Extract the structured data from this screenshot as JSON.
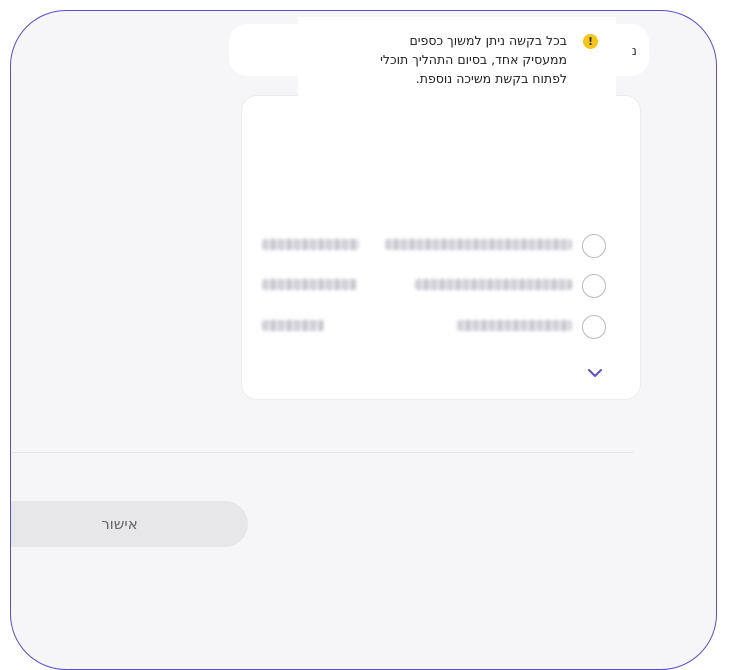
{
  "top_card": {
    "partial_text": "נ"
  },
  "tooltip": {
    "icon": "warning-icon",
    "lines": [
      "בכל בקשה ניתן למשוך כספים",
      "ממעסיק אחד, בסיום התהליך תוכלי",
      "לפתוח בקשת משיכה נוספת."
    ]
  },
  "options": [
    {
      "selected": false
    },
    {
      "selected": false
    },
    {
      "selected": false
    }
  ],
  "expand_icon": "chevron-down-icon",
  "confirm_button": {
    "label": "אישור"
  },
  "colors": {
    "accent": "#5b4fc7",
    "warning": "#f5c518",
    "background": "#f6f6f8",
    "card": "#ffffff",
    "button": "#e7e7ea"
  }
}
